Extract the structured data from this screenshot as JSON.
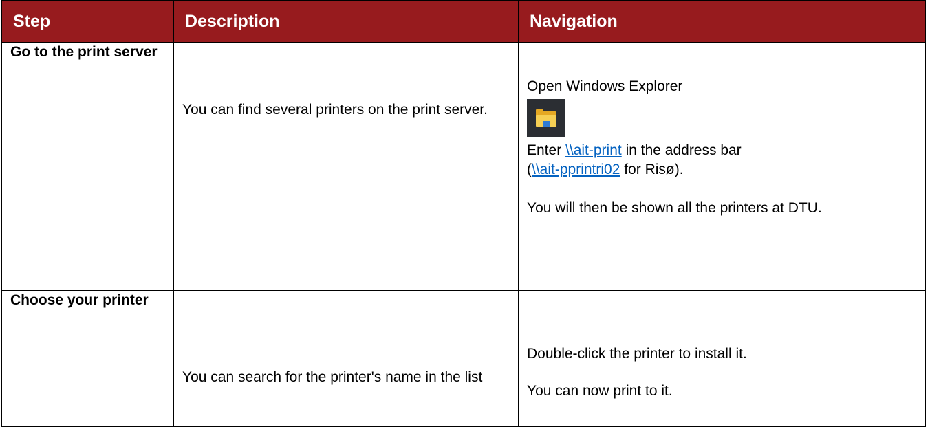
{
  "header": {
    "step": "Step",
    "description": "Description",
    "navigation": "Navigation"
  },
  "rows": [
    {
      "step": "Go to the print server",
      "description": "You can find several printers on the print server.",
      "navigation": {
        "line1": "Open Windows Explorer",
        "icon": "file-explorer-icon",
        "enter_prefix": "Enter ",
        "link1": "\\\\ait-print",
        "enter_suffix": " in the address bar",
        "paren_open": "(",
        "link2": "\\\\ait-pprintri02",
        "risoe_suffix": " for Risø).",
        "line_last": "You will then be shown all the printers at DTU."
      }
    },
    {
      "step": "Choose your printer",
      "description": "You can search for the printer's name in the list",
      "navigation": {
        "line1": "Double-click the printer to install it.",
        "line2": "You can now print to it."
      }
    }
  ],
  "colors": {
    "header_bg": "#971b1e",
    "header_text": "#ffffff",
    "link": "#0563c1"
  }
}
